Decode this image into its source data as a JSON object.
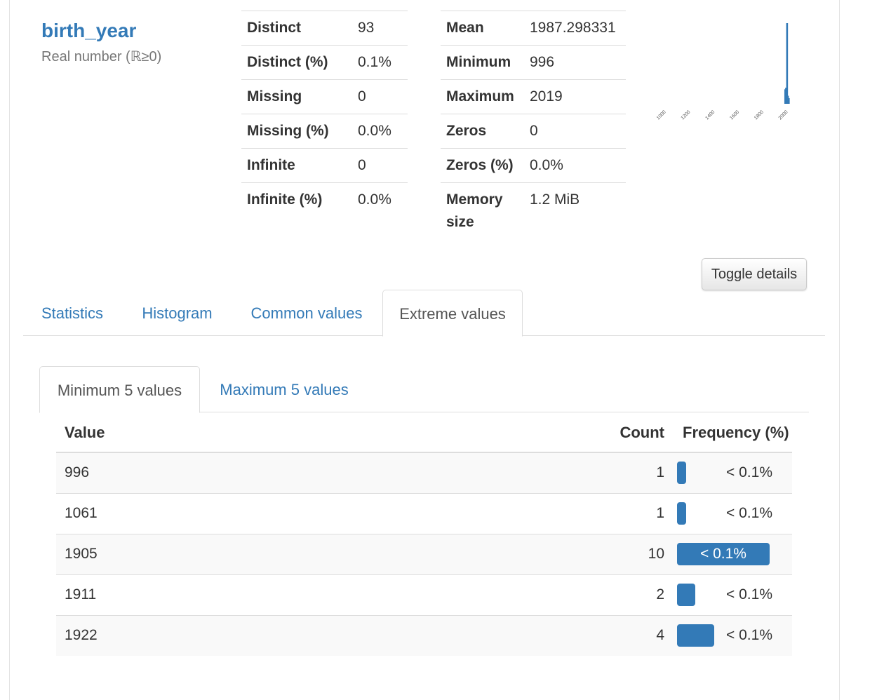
{
  "variable": {
    "name": "birth_year",
    "type": "Real number (ℝ≥0)"
  },
  "stats_left": [
    {
      "key": "Distinct",
      "value": "93"
    },
    {
      "key": "Distinct (%)",
      "value": "0.1%"
    },
    {
      "key": "Missing",
      "value": "0"
    },
    {
      "key": "Missing (%)",
      "value": "0.0%"
    },
    {
      "key": "Infinite",
      "value": "0"
    },
    {
      "key": "Infinite (%)",
      "value": "0.0%"
    }
  ],
  "stats_right": [
    {
      "key": "Mean",
      "value": "1987.298331"
    },
    {
      "key": "Minimum",
      "value": "996"
    },
    {
      "key": "Maximum",
      "value": "2019"
    },
    {
      "key": "Zeros",
      "value": "0"
    },
    {
      "key": "Zeros (%)",
      "value": "0.0%"
    },
    {
      "key": "Memory size",
      "value": "1.2 MiB"
    }
  ],
  "chart_data": {
    "type": "bar",
    "x_ticks": [
      "1000",
      "1200",
      "1400",
      "1600",
      "1800",
      "2000"
    ],
    "xlim": [
      900,
      2050
    ],
    "bars": [
      {
        "x": 1975,
        "value": 0.18
      },
      {
        "x": 1982,
        "value": 0.2
      },
      {
        "x": 1990,
        "value": 1.0
      },
      {
        "x": 1997,
        "value": 0.1
      },
      {
        "x": 2004,
        "value": 0.07
      }
    ],
    "color": "#337ab7"
  },
  "toggle_label": "Toggle details",
  "tabs": [
    {
      "label": "Statistics",
      "active": false
    },
    {
      "label": "Histogram",
      "active": false
    },
    {
      "label": "Common values",
      "active": false
    },
    {
      "label": "Extreme values",
      "active": true
    }
  ],
  "subtabs": [
    {
      "label": "Minimum 5 values",
      "active": true
    },
    {
      "label": "Maximum 5 values",
      "active": false
    }
  ],
  "table": {
    "headers": {
      "value": "Value",
      "count": "Count",
      "frequency": "Frequency (%)"
    },
    "rows": [
      {
        "value": "996",
        "count": "1",
        "frequency": "< 0.1%",
        "bar": 0.1
      },
      {
        "value": "1061",
        "count": "1",
        "frequency": "< 0.1%",
        "bar": 0.1
      },
      {
        "value": "1905",
        "count": "10",
        "frequency": "< 0.1%",
        "bar": 1.0
      },
      {
        "value": "1911",
        "count": "2",
        "frequency": "< 0.1%",
        "bar": 0.2
      },
      {
        "value": "1922",
        "count": "4",
        "frequency": "< 0.1%",
        "bar": 0.4
      }
    ]
  },
  "colors": {
    "accent": "#337ab7"
  }
}
